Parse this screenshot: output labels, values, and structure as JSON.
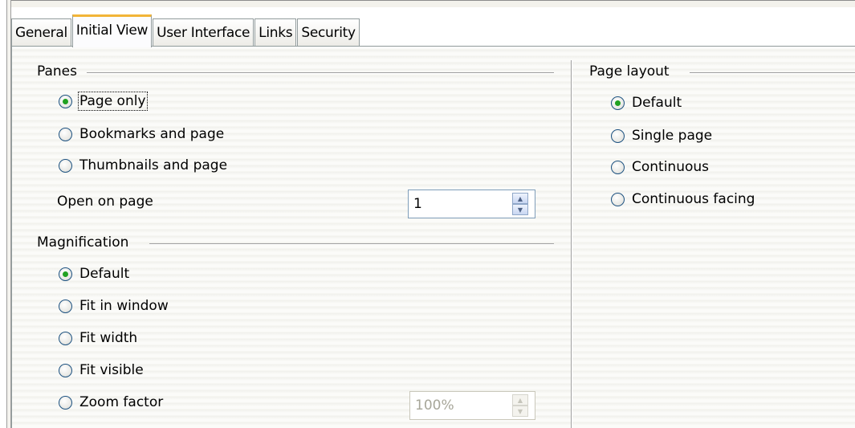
{
  "tabs": [
    "General",
    "Initial View",
    "User Interface",
    "Links",
    "Security"
  ],
  "panes": {
    "title": "Panes",
    "options": [
      "Page only",
      "Bookmarks and page",
      "Thumbnails and page"
    ],
    "selected": "Page only",
    "open_on_page_label": "Open on page",
    "open_on_page_value": "1"
  },
  "magnification": {
    "title": "Magnification",
    "options": [
      "Default",
      "Fit in window",
      "Fit width",
      "Fit visible",
      "Zoom factor"
    ],
    "selected": "Default",
    "zoom_value": "100%"
  },
  "page_layout": {
    "title": "Page layout",
    "options": [
      "Default",
      "Single page",
      "Continuous",
      "Continuous facing"
    ],
    "selected": "Default"
  },
  "colors": {
    "active_tab_accent": "#f2b437",
    "radio_dot": "#21a121"
  }
}
